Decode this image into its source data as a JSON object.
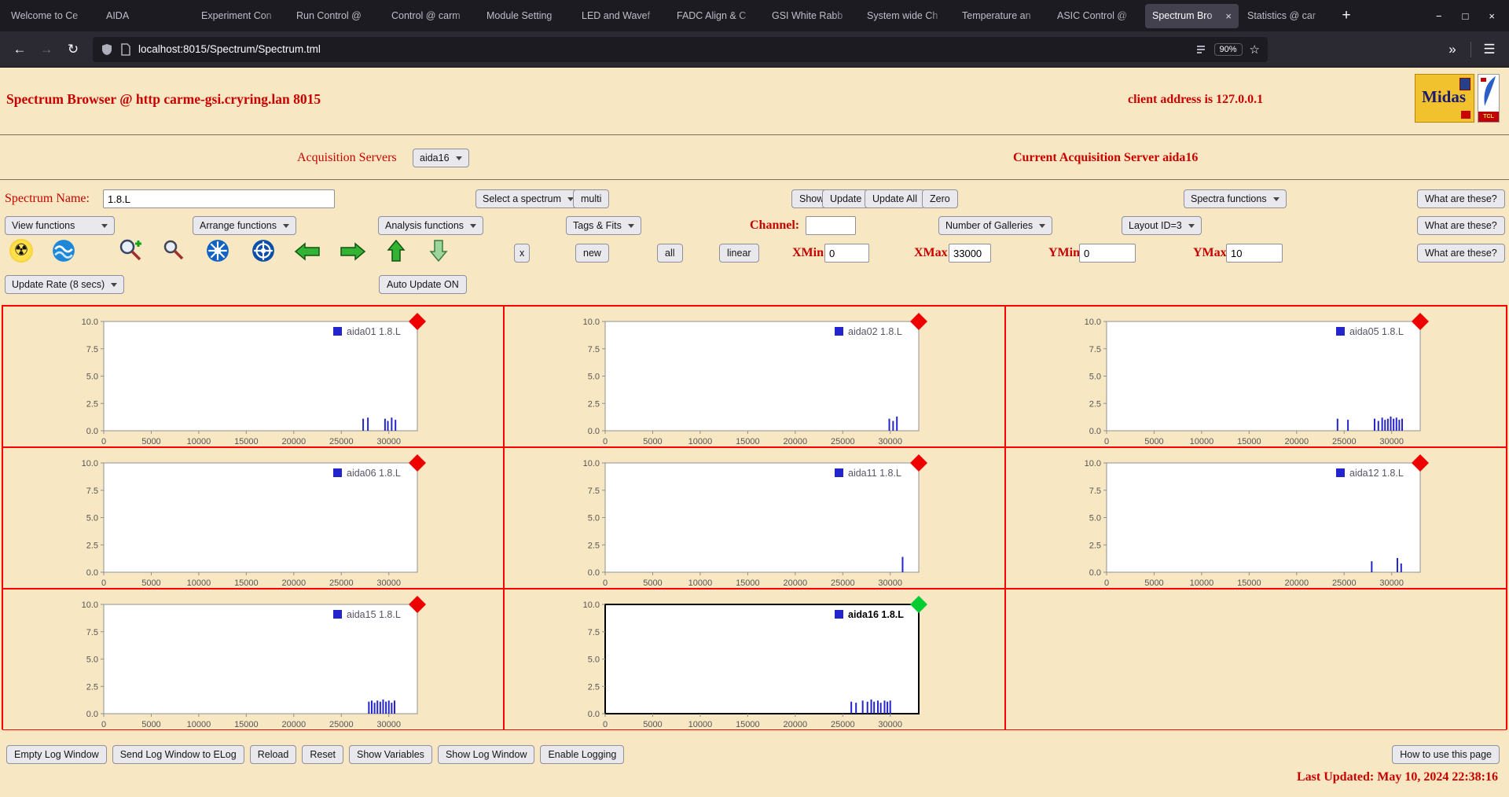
{
  "browser": {
    "tabs": [
      {
        "label": "Welcome to Ce"
      },
      {
        "label": "AIDA"
      },
      {
        "label": "Experiment Con"
      },
      {
        "label": "Run Control @ "
      },
      {
        "label": "Control @ carm"
      },
      {
        "label": "Module Setting"
      },
      {
        "label": "LED and Wavef"
      },
      {
        "label": "FADC Align & C"
      },
      {
        "label": "GSI White Rabb"
      },
      {
        "label": "System wide Ch"
      },
      {
        "label": "Temperature an"
      },
      {
        "label": "ASIC Control @"
      },
      {
        "label": "Spectrum Bro",
        "active": true
      },
      {
        "label": "Statistics @ car"
      }
    ],
    "new_tab_button": "+",
    "tab_close": "×",
    "window_controls": {
      "minimize": "−",
      "maximize": "□",
      "close": "×"
    },
    "nav": {
      "back": "←",
      "forward": "→",
      "reload": "↻",
      "url_host": "localhost:8015",
      "url_path": "/Spectrum/Spectrum.tml",
      "zoom": "90%",
      "star": "☆",
      "overflow": "»",
      "menu": "☰"
    }
  },
  "header": {
    "title": "Spectrum Browser @ http carme-gsi.cryring.lan 8015",
    "client": "client address is 127.0.0.1",
    "midas_logo_text": "Midas",
    "tcl_logo_text": "TCL"
  },
  "acquisition": {
    "label": "Acquisition Servers",
    "selected": "aida16",
    "current": "Current Acquisition Server aida16"
  },
  "controls": {
    "spectrum_name_label": "Spectrum Name:",
    "spectrum_name_value": "1.8.L",
    "select_spectrum": "Select a spectrum",
    "multi": "multi",
    "show": "Show",
    "update": "Update",
    "update_all": "Update All",
    "zero": "Zero",
    "spectra_functions": "Spectra functions",
    "what_are_these": "What are these?",
    "view_functions": "View functions",
    "arrange_functions": "Arrange functions",
    "analysis_functions": "Analysis functions",
    "tags_fits": "Tags & Fits",
    "channel_label": "Channel:",
    "channel_value": "",
    "number_of_galleries": "Number of Galleries",
    "layout_id": "Layout ID=3",
    "x_button": "x",
    "new_button": "new",
    "all_button": "all",
    "linear_button": "linear",
    "xmin_label": "XMin",
    "xmin_value": "0",
    "xmax_label": "XMax",
    "xmax_value": "33000",
    "ymin_label": "YMin",
    "ymin_value": "0",
    "ymax_label": "YMax",
    "ymax_value": "10",
    "update_rate": "Update Rate (8 secs)",
    "auto_update": "Auto Update ON"
  },
  "icons": {
    "radioactive": "☢",
    "water": "water-sphere",
    "zoom_in": "magnifier-plus",
    "zoom_out": "magnifier",
    "wheel_1": "blue-wheel",
    "wheel_2": "blue-wheel",
    "pan_left": "green-arrow-left",
    "pan_right": "green-arrow-right",
    "pan_up": "green-arrow-up",
    "pan_down": "green-arrow-down"
  },
  "footer": {
    "buttons": [
      "Empty Log Window",
      "Send Log Window to ELog",
      "Reload",
      "Reset",
      "Show Variables",
      "Show Log Window",
      "Enable Logging"
    ],
    "help_button": "How to use this page",
    "last_updated": "Last Updated: May 10, 2024 22:38:16"
  },
  "colors": {
    "page_bg": "#f8e7c3",
    "heading_red": "#c80000",
    "grid_border": "#ff0000",
    "spike_blue": "#2424cc",
    "marker_red": "#ee0000",
    "marker_green": "#00cc33",
    "selected_box": "#000000"
  },
  "chart_data": {
    "type": "bar",
    "title": "",
    "xlabel": "",
    "ylabel": "",
    "xlim": [
      0,
      33000
    ],
    "ylim": [
      0,
      10
    ],
    "x_ticks": [
      0,
      5000,
      10000,
      15000,
      20000,
      25000,
      30000
    ],
    "y_ticks": [
      0,
      2.5,
      5,
      7.5,
      10
    ],
    "grid": false,
    "legend_position": "top-right",
    "note": "Each panel is a sparse spike histogram (counts vs channel); spikes given as [x, height] pairs estimated from pixels.",
    "charts": [
      {
        "id": "aida01",
        "legend": "aida01 1.8.L",
        "row": 0,
        "col": 0,
        "selected": false,
        "spikes": [
          [
            27300,
            1.1
          ],
          [
            27800,
            1.2
          ],
          [
            29600,
            1.1
          ],
          [
            29900,
            0.9
          ],
          [
            30300,
            1.2
          ],
          [
            30700,
            1.0
          ]
        ]
      },
      {
        "id": "aida02",
        "legend": "aida02 1.8.L",
        "row": 0,
        "col": 1,
        "selected": false,
        "spikes": [
          [
            29900,
            1.1
          ],
          [
            30300,
            0.9
          ],
          [
            30700,
            1.3
          ]
        ]
      },
      {
        "id": "aida05",
        "legend": "aida05 1.8.L",
        "row": 0,
        "col": 2,
        "selected": false,
        "spikes": [
          [
            24300,
            1.1
          ],
          [
            25400,
            1.0
          ],
          [
            28200,
            1.1
          ],
          [
            28600,
            0.9
          ],
          [
            29000,
            1.2
          ],
          [
            29300,
            1.0
          ],
          [
            29600,
            1.1
          ],
          [
            29900,
            1.3
          ],
          [
            30200,
            1.1
          ],
          [
            30500,
            1.2
          ],
          [
            30800,
            1.0
          ],
          [
            31100,
            1.1
          ]
        ]
      },
      {
        "id": "aida06",
        "legend": "aida06 1.8.L",
        "row": 1,
        "col": 0,
        "selected": false,
        "spikes": []
      },
      {
        "id": "aida11",
        "legend": "aida11 1.8.L",
        "row": 1,
        "col": 1,
        "selected": false,
        "spikes": [
          [
            31300,
            1.4
          ]
        ]
      },
      {
        "id": "aida12",
        "legend": "aida12 1.8.L",
        "row": 1,
        "col": 2,
        "selected": false,
        "spikes": [
          [
            27900,
            1.0
          ],
          [
            30600,
            1.3
          ],
          [
            31000,
            0.8
          ]
        ]
      },
      {
        "id": "aida15",
        "legend": "aida15 1.8.L",
        "row": 2,
        "col": 0,
        "selected": false,
        "spikes": [
          [
            27900,
            1.1
          ],
          [
            28200,
            1.2
          ],
          [
            28500,
            1.0
          ],
          [
            28800,
            1.2
          ],
          [
            29100,
            1.1
          ],
          [
            29400,
            1.3
          ],
          [
            29700,
            1.1
          ],
          [
            30000,
            1.2
          ],
          [
            30300,
            1.0
          ],
          [
            30600,
            1.2
          ]
        ]
      },
      {
        "id": "aida16",
        "legend": "aida16 1.8.L",
        "row": 2,
        "col": 1,
        "selected": true,
        "spikes": [
          [
            25900,
            1.1
          ],
          [
            26400,
            1.0
          ],
          [
            27100,
            1.2
          ],
          [
            27600,
            1.1
          ],
          [
            28000,
            1.3
          ],
          [
            28300,
            1.1
          ],
          [
            28700,
            1.2
          ],
          [
            29000,
            1.0
          ],
          [
            29400,
            1.2
          ],
          [
            29700,
            1.1
          ],
          [
            30000,
            1.2
          ]
        ]
      }
    ]
  }
}
